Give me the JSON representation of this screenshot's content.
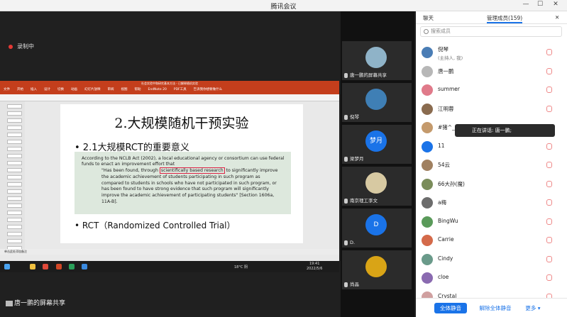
{
  "window": {
    "title": "腾讯会议"
  },
  "recording": {
    "label": "录制中"
  },
  "presentation": {
    "doc_title": "社会实验中和研究基本方法 - 已解释随机实验",
    "menu": [
      "文件",
      "开始",
      "插入",
      "设计",
      "切换",
      "动画",
      "幻灯片放映",
      "审阅",
      "视图",
      "帮助",
      "EndNote 20",
      "PDF工具",
      "告诉我你想要做什么"
    ],
    "slide_title": "2.大规模随机干预实验",
    "bullet1": "• 2.1大规模RCT的重要意义",
    "quote_intro": "According to the NCLB Act (2002), a local educational agency or consortium can use federal funds to enact an improvement effort that",
    "quote_pre": "\"Has been found, through ",
    "quote_highlight": "scientifically based research",
    "quote_post": " to significantly improve the academic achievement of students participating in such program as compared to students in schools who have not participated in such program, or has been found to have strong evidence that such program will significantly improve the academic achievement of participating students\" [Section 1606a, 11A-B].",
    "bullet2": "• RCT（Randomized Controlled Trial）",
    "notes_label": "单击此处添加备注",
    "taskbar_weather": "18°C 阴",
    "taskbar_time": "19:41",
    "taskbar_date": "2022/5/6"
  },
  "share_label": "唐一鹏的屏幕共享",
  "video_tiles": [
    {
      "name": "唐一鹏的屏幕共享",
      "color": "#8fb3c8"
    },
    {
      "name": "倪琴",
      "color": "#3f7fb5"
    },
    {
      "name": "梁梦月",
      "color": "#1a73e8",
      "initials": "梦月"
    },
    {
      "name": "南京理工李文",
      "color": "#d7c9a2"
    },
    {
      "name": "D.",
      "color": "#1a73e8",
      "initials": "D"
    },
    {
      "name": "尚晶",
      "color": "#d9a416"
    }
  ],
  "panel": {
    "tab_chat": "聊天",
    "tab_members": "管理成员(159)",
    "search_placeholder": "搜索成员",
    "members": [
      {
        "name": "倪琴",
        "sub": "(主持人, 我)",
        "color": "#4a7db5"
      },
      {
        "name": "唐一鹏",
        "color": "#b7b7b7"
      },
      {
        "name": "summer",
        "color": "#e07a8a"
      },
      {
        "name": "江明蓉",
        "color": "#8a6b4f"
      },
      {
        "name": "#猪^_",
        "color": "#c49a6c"
      },
      {
        "name": "11",
        "color": "#1a73e8"
      },
      {
        "name": "54云",
        "color": "#a08060"
      },
      {
        "name": "66大孙(魔)",
        "color": "#7a8c5a"
      },
      {
        "name": "a梅",
        "color": "#6c6c6c"
      },
      {
        "name": "BingWu",
        "color": "#5a9a5a"
      },
      {
        "name": "Carrie",
        "color": "#d46a4a"
      },
      {
        "name": "Cindy",
        "color": "#6a9a8a"
      },
      {
        "name": "cloe",
        "color": "#8a6ab0"
      },
      {
        "name": "Crystal",
        "color": "#d0a0a0"
      }
    ],
    "speaking_tooltip": "正在讲话: 唐一鹏;",
    "btn_mute_all": "全体静音",
    "btn_unmute_all": "解除全体静音",
    "btn_more": "更多 ▾"
  }
}
